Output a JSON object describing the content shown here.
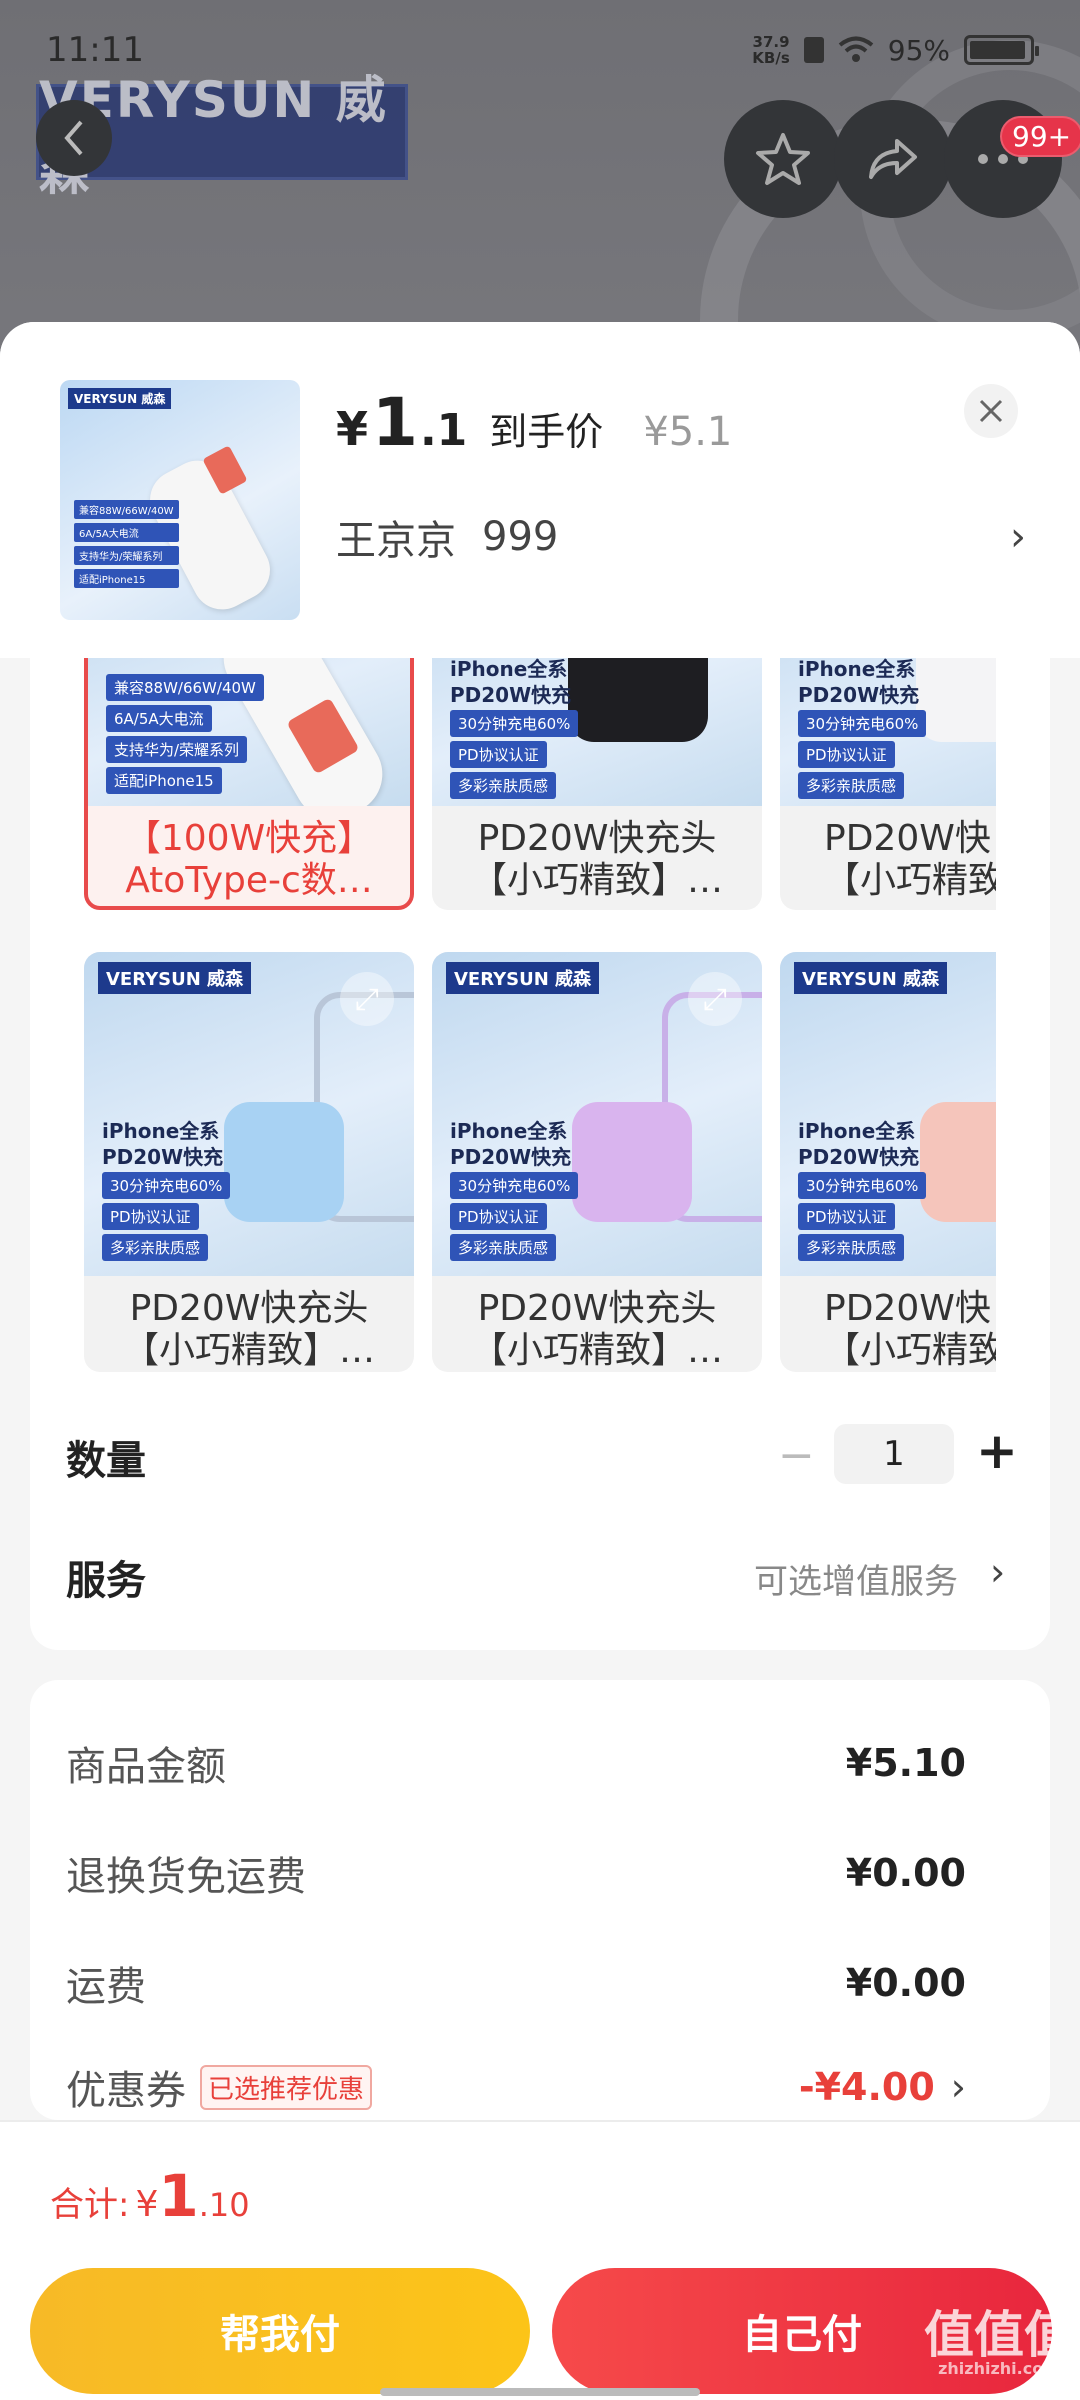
{
  "status_bar": {
    "time": "11:11",
    "speed_value": "37.9",
    "speed_unit": "KB/s",
    "battery": "95%"
  },
  "background": {
    "brand": "VERYSUN 威森",
    "badge": "99+"
  },
  "header": {
    "price_symbol": "¥",
    "price_int": "1",
    "price_dec": ".1",
    "price_label": "到手价",
    "original_price": "¥5.1",
    "seller_name": "王京京",
    "seller_num": "999",
    "thumb_logo": "VERYSUN 威森",
    "thumb_tags": [
      "兼容88W/66W/40W",
      "6A/5A大电流",
      "支持华为/荣耀系列",
      "适配iPhone15"
    ]
  },
  "skus": [
    {
      "name1": "【100W快充】",
      "name2": "AtoType-c数…",
      "selected": true,
      "tags": [
        "兼容88W/66W/40W",
        "6A/5A大电流",
        "支持华为/荣耀系列",
        "适配iPhone15"
      ]
    },
    {
      "name1": "PD20W快充头",
      "name2": "【小巧精致】…",
      "title1": "iPhone全系",
      "title2": "PD20W快充",
      "tags": [
        "30分钟充电60%",
        "PD协议认证",
        "多彩亲肤质感"
      ]
    },
    {
      "name1": "PD20W快",
      "name2": "【小巧精致",
      "title1": "iPhone全系",
      "title2": "PD20W快充",
      "tags": [
        "30分钟充电60%",
        "PD协议认证",
        "多彩亲肤质感"
      ]
    },
    {
      "name1": "PD20W快充头",
      "name2": "【小巧精致】…",
      "logo": "VERYSUN 威森",
      "title1": "iPhone全系",
      "title2": "PD20W快充",
      "tags": [
        "30分钟充电60%",
        "PD协议认证",
        "多彩亲肤质感"
      ]
    },
    {
      "name1": "PD20W快充头",
      "name2": "【小巧精致】…",
      "logo": "VERYSUN 威森",
      "title1": "iPhone全系",
      "title2": "PD20W快充",
      "tags": [
        "30分钟充电60%",
        "PD协议认证",
        "多彩亲肤质感"
      ]
    },
    {
      "name1": "PD20W快",
      "name2": "【小巧精致",
      "logo": "VERYSUN 威森",
      "title1": "iPhone全系",
      "title2": "PD20W快充",
      "tags": [
        "30分钟充电60%",
        "PD协议认证",
        "多彩亲肤质感"
      ]
    }
  ],
  "quantity": {
    "label": "数量",
    "minus": "−",
    "value": "1",
    "plus": "+"
  },
  "service": {
    "label": "服务",
    "value": "可选增值服务"
  },
  "summary": {
    "goods_label": "商品金额",
    "goods_value": "¥5.10",
    "return_label": "退换货免运费",
    "return_value": "¥0.00",
    "shipping_label": "运费",
    "shipping_value": "¥0.00",
    "coupon_label": "优惠券",
    "coupon_tag": "已选推荐优惠",
    "coupon_value": "-¥4.00"
  },
  "bottom": {
    "total_label": "合计:",
    "total_symbol": "¥",
    "total_int": "1",
    "total_dec": ".10",
    "help_pay": "帮我付",
    "self_pay": "自己付"
  },
  "watermark": {
    "main": "值值值",
    "sub": "zhizhizhi.com"
  },
  "colors": {
    "accent_red": "#e8403a",
    "button_yellow": "#f7ba27",
    "button_red": "#f64a4a"
  },
  "icons": [
    "back-icon",
    "star-icon",
    "share-icon",
    "more-icon",
    "close-icon",
    "chevron-right-icon",
    "expand-icon",
    "wifi-icon"
  ]
}
